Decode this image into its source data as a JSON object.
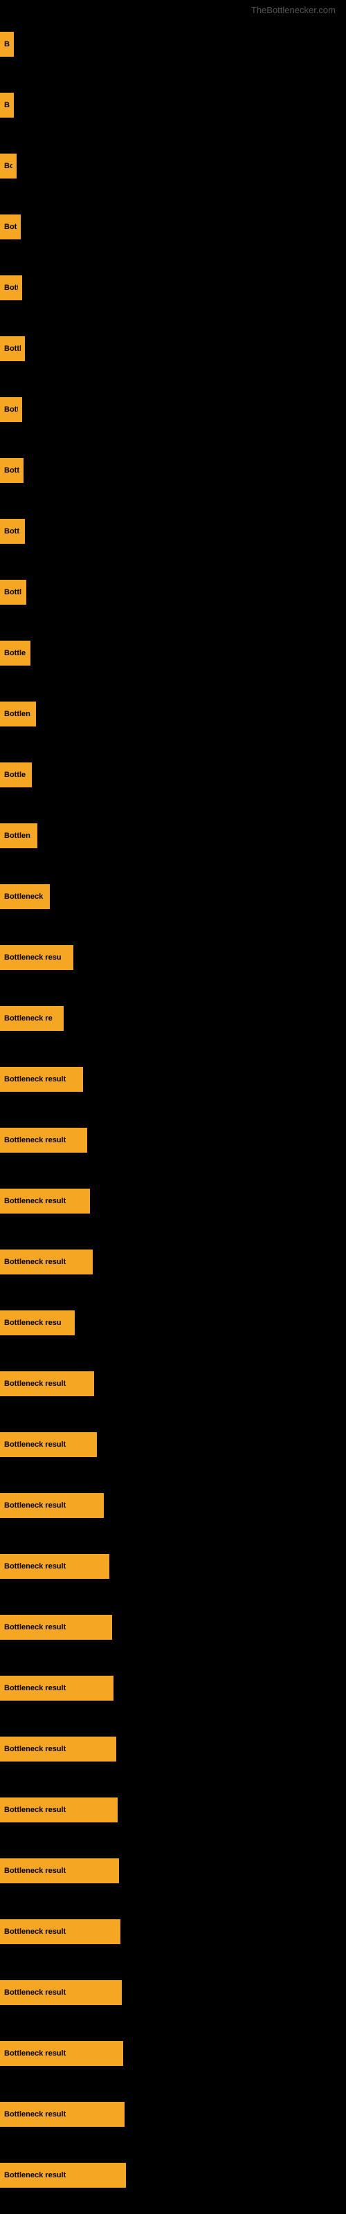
{
  "site": {
    "title": "TheBottlenecker.com"
  },
  "bars": [
    {
      "id": 1,
      "label": "Bo",
      "width": 20
    },
    {
      "id": 2,
      "label": "Bo",
      "width": 20
    },
    {
      "id": 3,
      "label": "Bot",
      "width": 24
    },
    {
      "id": 4,
      "label": "Bott",
      "width": 30
    },
    {
      "id": 5,
      "label": "Bott",
      "width": 32
    },
    {
      "id": 6,
      "label": "Bottl",
      "width": 36
    },
    {
      "id": 7,
      "label": "Bott",
      "width": 32
    },
    {
      "id": 8,
      "label": "Bott",
      "width": 34
    },
    {
      "id": 9,
      "label": "Bott",
      "width": 36
    },
    {
      "id": 10,
      "label": "Bottl",
      "width": 38
    },
    {
      "id": 11,
      "label": "Bottle",
      "width": 44
    },
    {
      "id": 12,
      "label": "Bottlen",
      "width": 52
    },
    {
      "id": 13,
      "label": "Bottle",
      "width": 46
    },
    {
      "id": 14,
      "label": "Bottlen",
      "width": 54
    },
    {
      "id": 15,
      "label": "Bottleneck",
      "width": 72
    },
    {
      "id": 16,
      "label": "Bottleneck resu",
      "width": 106
    },
    {
      "id": 17,
      "label": "Bottleneck re",
      "width": 92
    },
    {
      "id": 18,
      "label": "Bottleneck result",
      "width": 120
    },
    {
      "id": 19,
      "label": "Bottleneck result",
      "width": 126
    },
    {
      "id": 20,
      "label": "Bottleneck result",
      "width": 130
    },
    {
      "id": 21,
      "label": "Bottleneck result",
      "width": 134
    },
    {
      "id": 22,
      "label": "Bottleneck resu",
      "width": 108
    },
    {
      "id": 23,
      "label": "Bottleneck result",
      "width": 136
    },
    {
      "id": 24,
      "label": "Bottleneck result",
      "width": 140
    },
    {
      "id": 25,
      "label": "Bottleneck result",
      "width": 150
    },
    {
      "id": 26,
      "label": "Bottleneck result",
      "width": 158
    },
    {
      "id": 27,
      "label": "Bottleneck result",
      "width": 162
    },
    {
      "id": 28,
      "label": "Bottleneck result",
      "width": 164
    },
    {
      "id": 29,
      "label": "Bottleneck result",
      "width": 168
    },
    {
      "id": 30,
      "label": "Bottleneck result",
      "width": 170
    },
    {
      "id": 31,
      "label": "Bottleneck result",
      "width": 172
    },
    {
      "id": 32,
      "label": "Bottleneck result",
      "width": 174
    },
    {
      "id": 33,
      "label": "Bottleneck result",
      "width": 176
    },
    {
      "id": 34,
      "label": "Bottleneck result",
      "width": 178
    },
    {
      "id": 35,
      "label": "Bottleneck result",
      "width": 180
    },
    {
      "id": 36,
      "label": "Bottleneck result",
      "width": 182
    }
  ]
}
